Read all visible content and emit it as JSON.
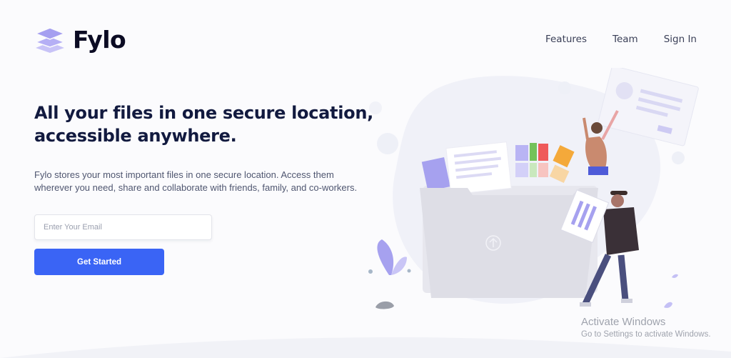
{
  "brand": {
    "name": "Fylo",
    "logo_icon": "layers-icon",
    "logo_color": "#a59ff0"
  },
  "nav": {
    "items": [
      {
        "label": "Features"
      },
      {
        "label": "Team"
      },
      {
        "label": "Sign In"
      }
    ]
  },
  "hero": {
    "title_line1": "All your files in one secure location,",
    "title_line2": "accessible anywhere.",
    "description": "Fylo stores your most important files in one secure location. Access them wherever you need, share and collaborate with friends, family, and co-workers.",
    "email_placeholder": "Enter Your Email",
    "email_value": "",
    "cta_label": "Get Started"
  },
  "illustration": {
    "name": "file-folder-illustration",
    "upload_icon": "upload-arrow-icon"
  },
  "system_overlay": {
    "line1": "Activate Windows",
    "line2": "Go to Settings to activate Windows."
  },
  "colors": {
    "accent": "#3a64f5",
    "heading": "#121a3f",
    "body_text": "#4f5670",
    "logo_purple": "#a59ff0"
  }
}
